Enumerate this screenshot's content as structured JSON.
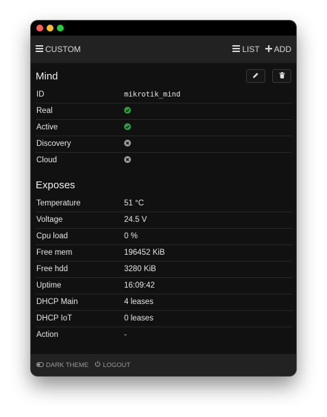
{
  "window": {
    "title": ""
  },
  "nav": {
    "custom_label": "CUSTOM",
    "list_label": "LIST",
    "add_label": "ADD"
  },
  "mind": {
    "title": "Mind",
    "rows": [
      {
        "label": "ID",
        "value": "mikrotik_mind",
        "type": "text"
      },
      {
        "label": "Real",
        "value": "",
        "type": "check",
        "icon": "check-circle-icon"
      },
      {
        "label": "Active",
        "value": "",
        "type": "check",
        "icon": "check-circle-icon"
      },
      {
        "label": "Discovery",
        "value": "",
        "type": "cross",
        "icon": "x-circle-icon"
      },
      {
        "label": "Cloud",
        "value": "",
        "type": "cross",
        "icon": "x-circle-icon"
      }
    ]
  },
  "exposes": {
    "title": "Exposes",
    "rows": [
      {
        "label": "Temperature",
        "value": "51 °C"
      },
      {
        "label": "Voltage",
        "value": "24.5 V"
      },
      {
        "label": "Cpu load",
        "value": "0 %"
      },
      {
        "label": "Free mem",
        "value": "196452 KiB"
      },
      {
        "label": "Free hdd",
        "value": "3280 KiB"
      },
      {
        "label": "Uptime",
        "value": "16:09:42"
      },
      {
        "label": "DHCP Main",
        "value": "4 leases"
      },
      {
        "label": "DHCP IoT",
        "value": "0 leases"
      },
      {
        "label": "Action",
        "value": "-"
      }
    ]
  },
  "footer": {
    "dark_theme_label": "DARK THEME",
    "logout_label": "LOGOUT"
  },
  "colors": {
    "check": "#2ea043",
    "cross": "#9a9a9a",
    "background": "#111111",
    "bar": "#222222"
  }
}
